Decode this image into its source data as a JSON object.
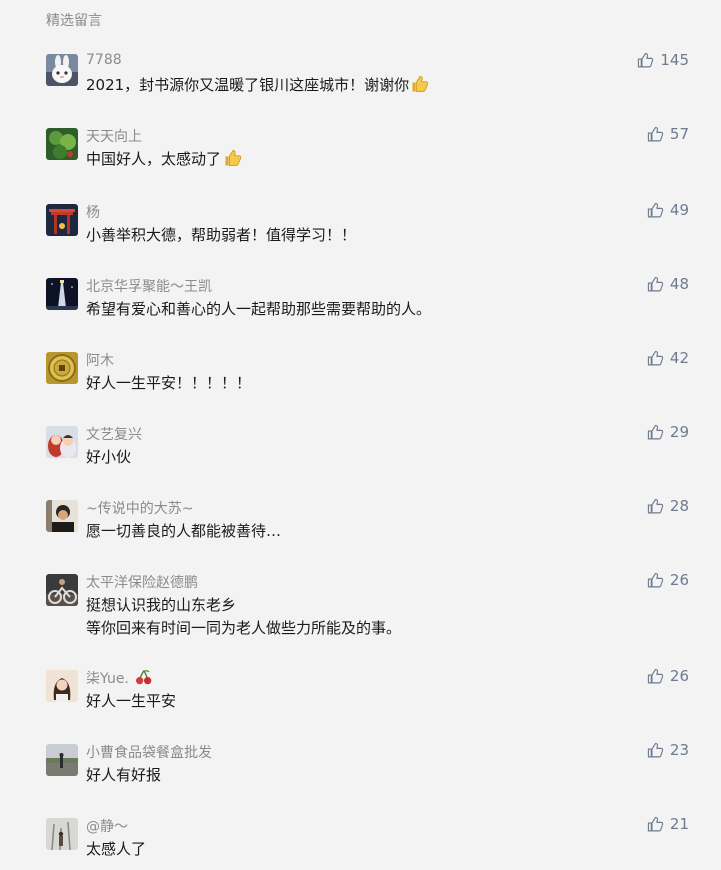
{
  "section_title": "精选留言",
  "comments": [
    {
      "nickname": "7788",
      "content": "2021，封书源你又温暖了银川这座城市！谢谢你",
      "content_emoji": "thumbs-up-icon",
      "likes": "145",
      "avatar": "rabbit-avatar"
    },
    {
      "nickname": "天天向上",
      "content": "中国好人，太感动了",
      "content_emoji": "thumbs-up-icon",
      "likes": "57",
      "avatar": "plant-avatar"
    },
    {
      "nickname": "杨",
      "content": "小善举积大德，帮助弱者！值得学习！！",
      "likes": "49",
      "avatar": "gate-avatar"
    },
    {
      "nickname": "北京华孚聚能～王凯",
      "content": "希望有爱心和善心的人一起帮助那些需要帮助的人。",
      "likes": "48",
      "avatar": "tower-avatar"
    },
    {
      "nickname": "阿木",
      "content": "好人一生平安！！！！！",
      "likes": "42",
      "avatar": "coin-avatar"
    },
    {
      "nickname": "文艺复兴",
      "content": "好小伙",
      "likes": "29",
      "avatar": "child-avatar"
    },
    {
      "nickname": "~传说中的大苏~",
      "content": "愿一切善良的人都能被善待…",
      "likes": "28",
      "avatar": "person-avatar"
    },
    {
      "nickname": "太平洋保险赵德鹏",
      "content": "挺想认识我的山东老乡\n等你回来有时间一同为老人做些力所能及的事。",
      "likes": "26",
      "avatar": "bike-avatar"
    },
    {
      "nickname": "柒Yue.",
      "nickname_emoji": "cherries-icon",
      "content": "好人一生平安",
      "likes": "26",
      "avatar": "girl-avatar"
    },
    {
      "nickname": "小曹食品袋餐盒批发",
      "content": "好人有好报",
      "likes": "23",
      "avatar": "road-avatar"
    },
    {
      "nickname": "@静～",
      "content": "太感人了",
      "likes": "21",
      "avatar": "winter-avatar"
    }
  ]
}
